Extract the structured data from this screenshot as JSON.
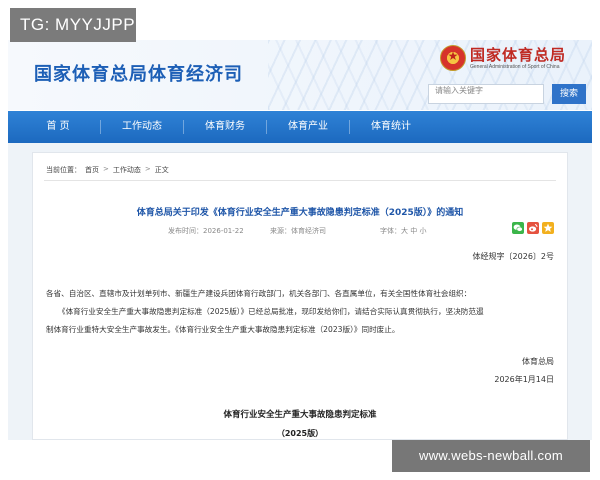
{
  "overlay_tag": "TG: MYYJJPP",
  "header": {
    "site_title": "国家体育总局体育经济司",
    "logo_cn": "国家体育总局",
    "logo_en": "General Administration of Sport of China",
    "search_placeholder": "请输入关键字",
    "search_button": "搜索"
  },
  "nav": {
    "items": [
      "首 页",
      "工作动态",
      "体育财务",
      "体育产业",
      "体育统计"
    ]
  },
  "breadcrumb": {
    "label": "当前位置：",
    "items": [
      "首页",
      "工作动态",
      "正文"
    ],
    "separator": ">"
  },
  "article": {
    "title": "体育总局关于印发《体育行业安全生产重大事故隐患判定标准（2025版）》的通知",
    "date": "发布时间：2026-01-22",
    "source": "来源：体育经济司",
    "font_size": "字体：大 中 小",
    "doc_no": "体经规字〔2026〕2号",
    "paragraphs": [
      "各省、自治区、直辖市及计划单列市、新疆生产建设兵团体育行政部门，机关各部门、各直属单位，有关全国性体育社会组织：",
      "《体育行业安全生产重大事故隐患判定标准（2025版）》已经总局批准，现印发给你们，请结合实际认真贯彻执行，坚决防范遏",
      "制体育行业重特大安全生产事故发生。《体育行业安全生产重大事故隐患判定标准（2023版）》同时废止。"
    ],
    "sign_org": "体育总局",
    "sign_date": "2026年1月14日",
    "annex_title": "体育行业安全生产重大事故隐患判定标准",
    "annex_sub": "（2025版）"
  },
  "share_icons": [
    "wechat-icon",
    "weibo-icon",
    "qzone-icon"
  ],
  "watermark": "www.webs-newball.com",
  "colors": {
    "nav_blue": "#1c69bf",
    "title_blue": "#1f56a8",
    "logo_red": "#c02a23"
  }
}
